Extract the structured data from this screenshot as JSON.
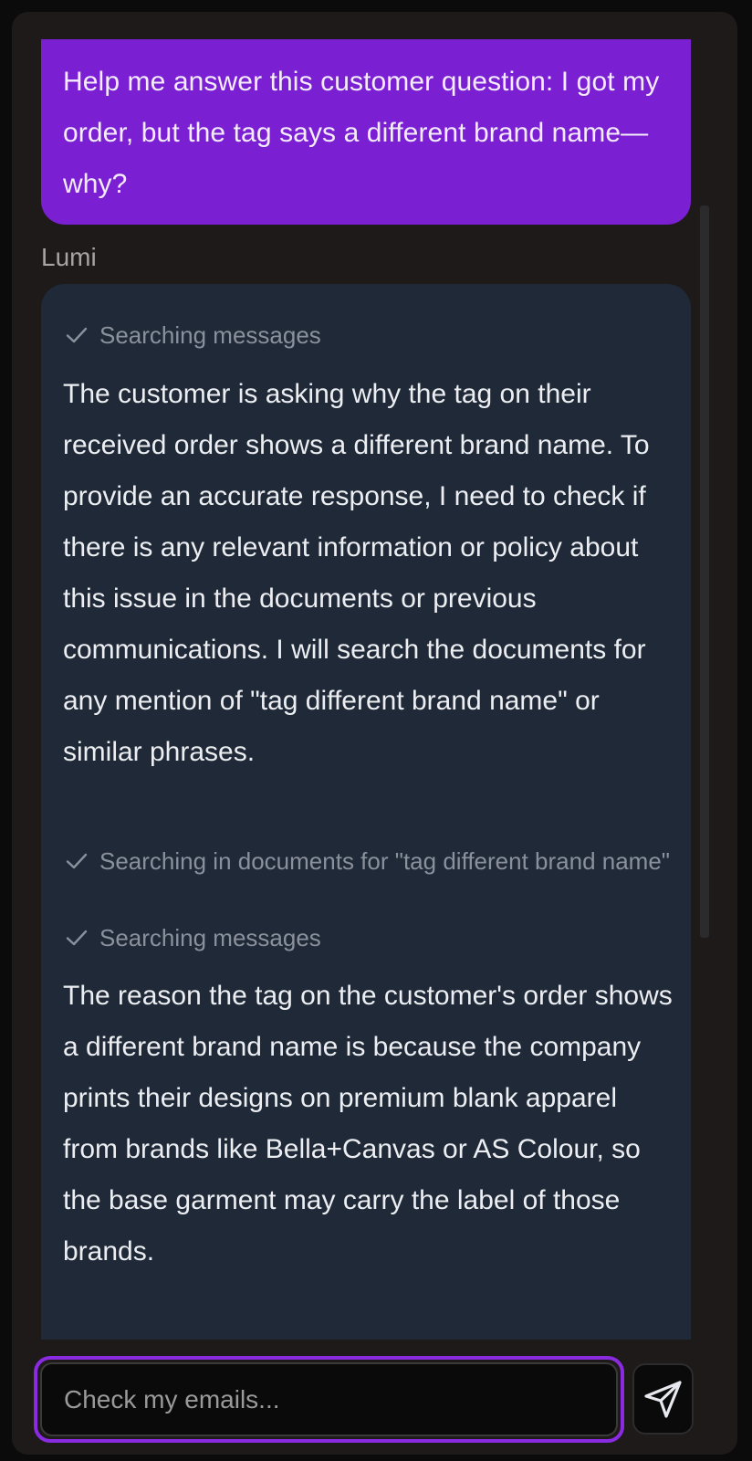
{
  "thread": {
    "user_message": "Help me answer this customer question: I got my order, but the tag says a different brand name—why?",
    "assistant_name": "Lumi",
    "steps": [
      {
        "label": "Searching messages"
      },
      {
        "label": "Searching in documents for \"tag different brand name\""
      },
      {
        "label": "Searching messages"
      }
    ],
    "paragraphs": [
      "The customer is asking why the tag on their received order shows a different brand name. To provide an accurate response, I need to check if there is any relevant information or policy about this issue in the documents or previous communications. I will search the documents for any mention of \"tag different brand name\" or similar phrases.",
      "The reason the tag on the customer's order shows a different brand name is because the company prints their designs on premium blank apparel from brands like Bella+Canvas or AS Colour, so the base garment may carry the label of those brands."
    ]
  },
  "composer": {
    "placeholder": "Check my emails..."
  },
  "icons": {
    "step_icon": "check-icon",
    "send_icon": "send-icon"
  },
  "colors": {
    "user_bubble": "#7a1fd1",
    "assistant_bubble": "#1f2937",
    "input_focus_ring": "#8a2be2",
    "background": "#1d1a19"
  }
}
